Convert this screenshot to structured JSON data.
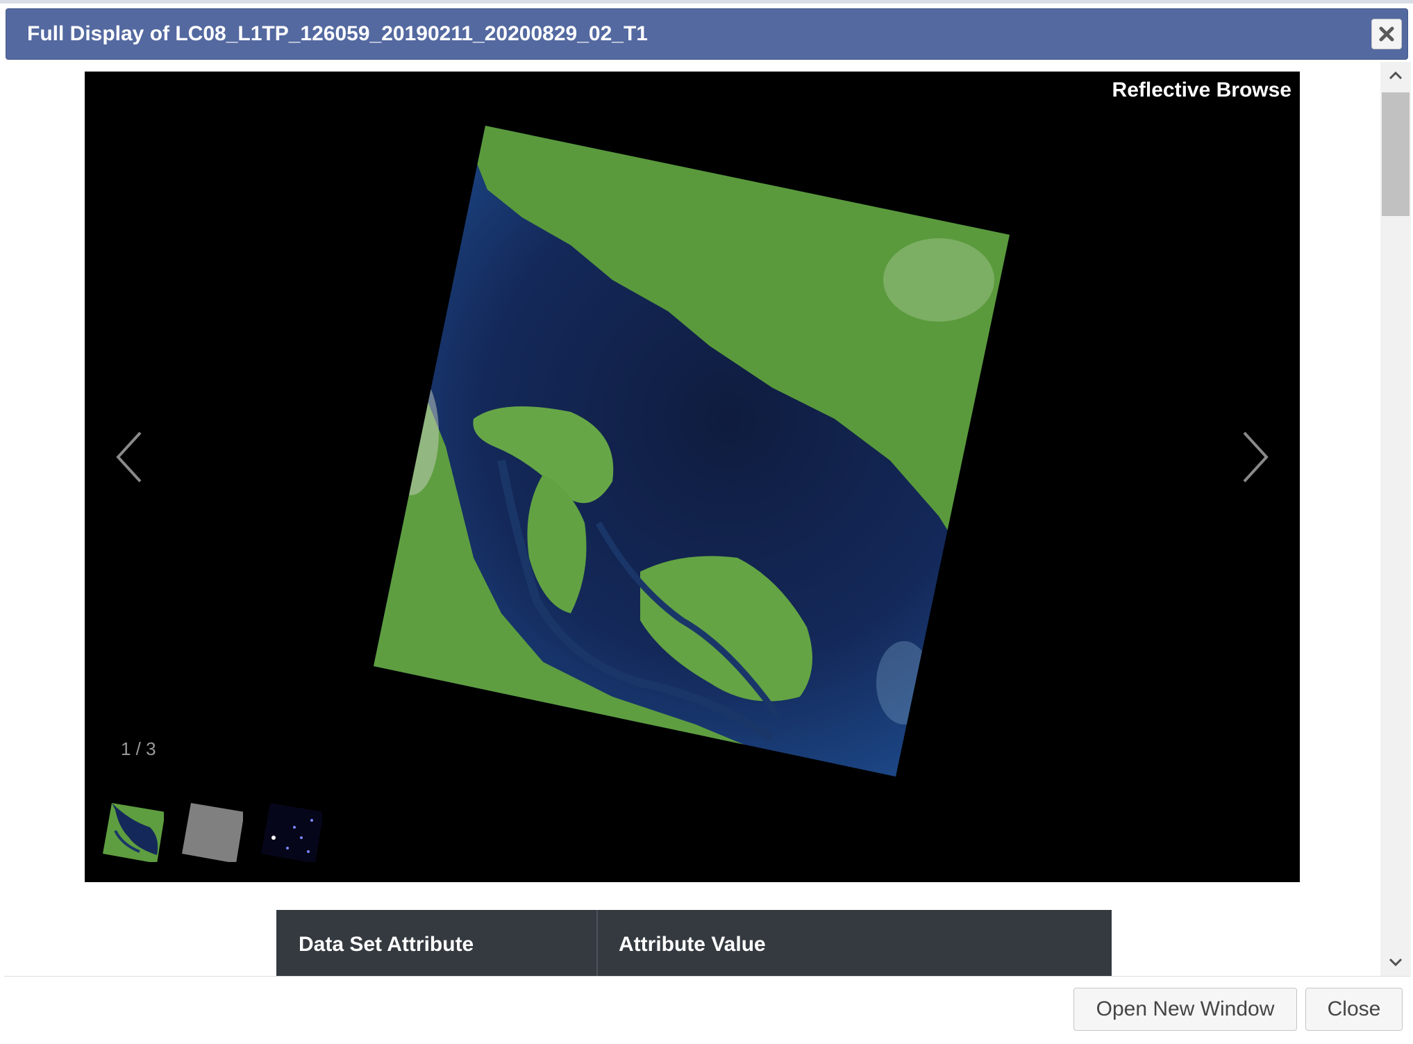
{
  "dialog": {
    "title": "Full Display of LC08_L1TP_126059_20190211_20200829_02_T1",
    "close_icon": "close-x-icon"
  },
  "viewer": {
    "image_label": "Reflective Browse",
    "counter": "1 / 3",
    "prev_icon": "chevron-left-icon",
    "next_icon": "chevron-right-icon",
    "thumbnails": [
      "reflective-thumbnail",
      "gray-thumbnail",
      "dark-thumbnail"
    ]
  },
  "table": {
    "headers": [
      "Data Set Attribute",
      "Attribute Value"
    ]
  },
  "footer": {
    "open_new_window_label": "Open New Window",
    "close_label": "Close"
  },
  "colors": {
    "titlebar": "#5469a0",
    "table_header": "#343a40",
    "viewer_background": "#000000"
  }
}
